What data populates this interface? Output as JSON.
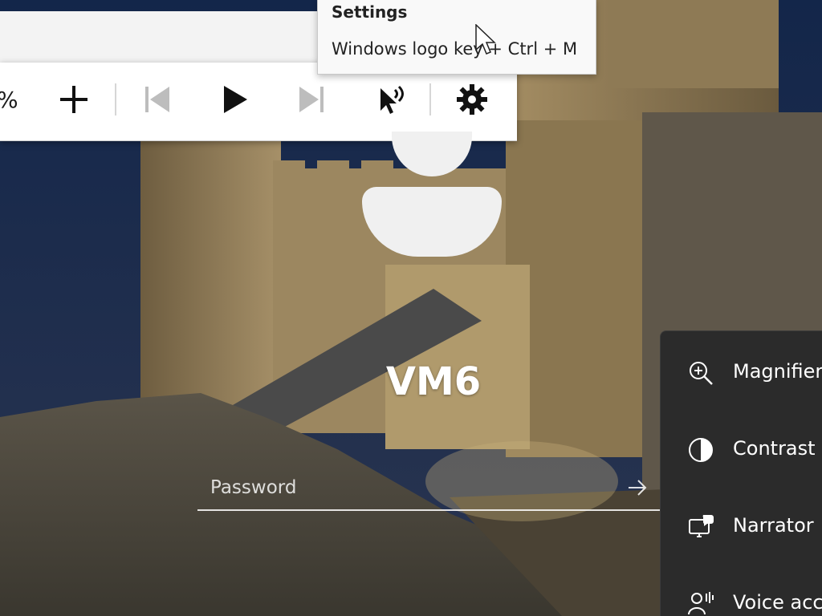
{
  "magnifier": {
    "zoom_level": "%",
    "zoom_in_icon": "plus-icon",
    "previous_icon": "skip-previous-icon",
    "play_icon": "play-icon",
    "next_icon": "skip-next-icon",
    "read_from_here_icon": "read-from-here-icon",
    "settings_icon": "gear-icon"
  },
  "tooltip": {
    "title": "Settings",
    "shortcut": "Windows logo key + Ctrl + M"
  },
  "login": {
    "username": "VM6",
    "password_placeholder": "Password",
    "submit_icon": "arrow-right-icon"
  },
  "accessibility": {
    "items": [
      {
        "label": "Magnifier",
        "icon": "zoom-in-icon"
      },
      {
        "label": "Contrast",
        "icon": "contrast-icon"
      },
      {
        "label": "Narrator",
        "icon": "narrator-icon"
      },
      {
        "label": "Voice access",
        "icon": "voice-access-icon"
      }
    ]
  },
  "colors": {
    "panel_bg": "#2b2b2b",
    "toolbar_bg": "#ffffff",
    "sky": "#1a2a44",
    "stone": "#a08a5e"
  }
}
